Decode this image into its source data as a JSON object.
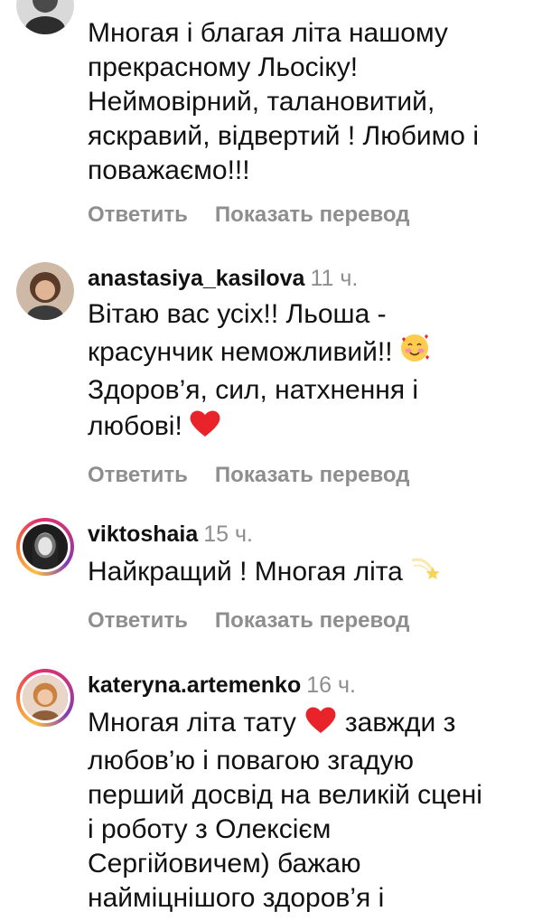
{
  "comments": [
    {
      "username": "",
      "time": "",
      "lines": [
        "Многая і благая літа нашому",
        "прекрасному  Льосіку!",
        "Неймовірний, талановитий,",
        "яскравий, відвертий ! Любимо і",
        "поважаємо!!!"
      ],
      "avatar_icon": "profile-photo-icon"
    },
    {
      "username": "anastasiya_kasilova",
      "time": "11 ч.",
      "lines": [
        "Вітаю вас усіх!! Льоша -",
        "красунчик неможливий!!",
        "Здоров’я, сил, натхнення і",
        "любові!"
      ],
      "emojis": [
        "smiling-face-with-hearts-emoji",
        "red-heart-emoji"
      ],
      "avatar_icon": "profile-photo-icon"
    },
    {
      "username": "viktoshaia",
      "time": "15 ч.",
      "lines": [
        "Найкращий ! Многая літа"
      ],
      "emojis": [
        "dizzy-emoji"
      ],
      "avatar_icon": "profile-photo-icon"
    },
    {
      "username": "kateryna.artemenko",
      "time": "16 ч.",
      "lines": [
        "Многая літа тату",
        "любов’ю і повагою згадую",
        "перший досвід на великій сцені",
        "і роботу з Олексієм",
        "Сергійовичем) бажаю",
        "найміцнішого здоров’я і"
      ],
      "line_suffix_after_emoji": "завжди з",
      "emojis": [
        "red-heart-emoji"
      ],
      "avatar_icon": "profile-photo-icon"
    }
  ],
  "actions": {
    "reply_label": "Ответить",
    "translate_label": "Показать перевод"
  },
  "colors": {
    "text": "#111111",
    "secondary": "#8e8e8e",
    "heart": "#e8232a"
  }
}
